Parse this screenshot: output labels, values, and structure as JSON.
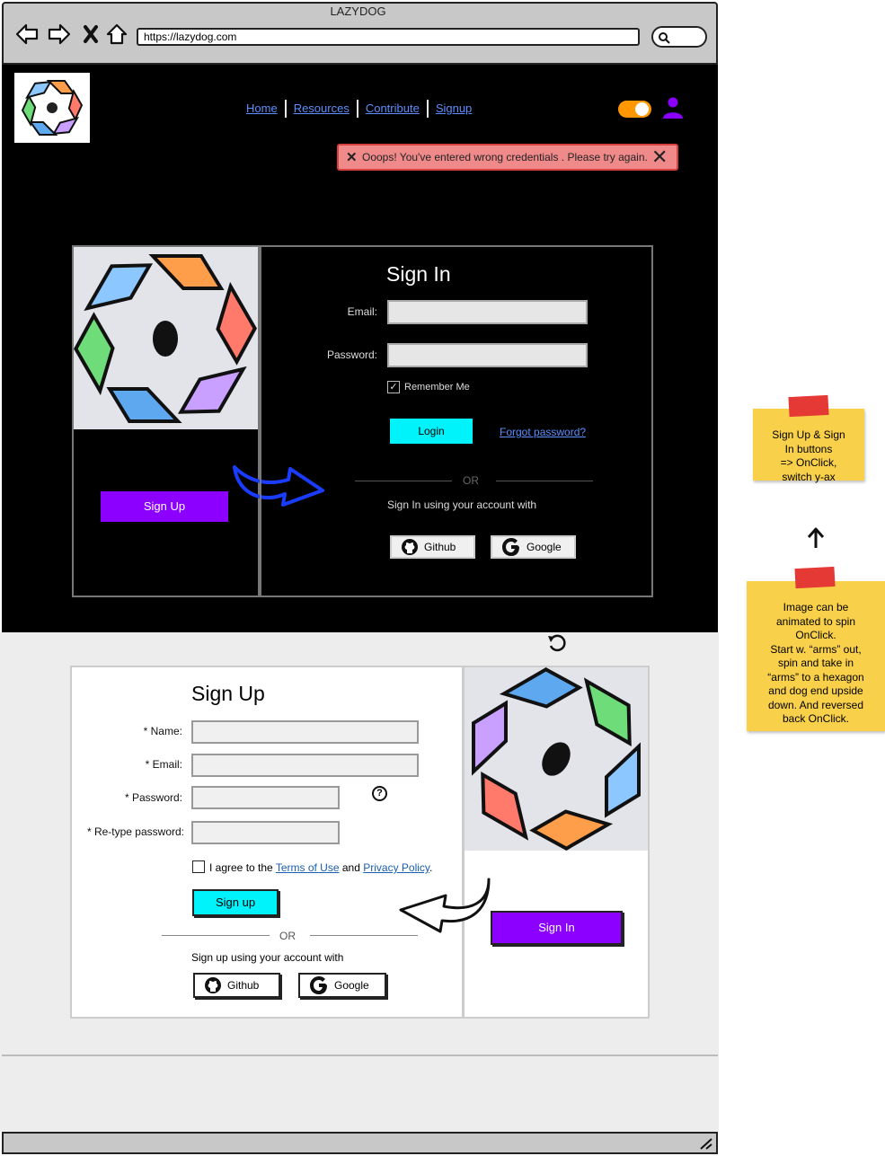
{
  "browser": {
    "title": "LAZYDOG",
    "url": "https://lazydog.com"
  },
  "nav": {
    "items": [
      "Home",
      "Resources",
      "Contribute",
      "Signup"
    ]
  },
  "alert": {
    "message": "Ooops! You've entered wrong credentials . Please try again."
  },
  "signin": {
    "title": "Sign In",
    "email_label": "Email:",
    "password_label": "Password:",
    "remember_label": "Remember Me",
    "remember_checked": true,
    "login_label": "Login",
    "forgot_label": "Forgot password?",
    "or_label": "OR",
    "social_text": "Sign In using your account with",
    "github_label": "Github",
    "google_label": "Google",
    "switch_label": "Sign Up"
  },
  "signup": {
    "title": "Sign Up",
    "name_label": "* Name:",
    "email_label": "* Email:",
    "password_label": "* Password:",
    "repassword_label": "* Re-type password:",
    "agree_prefix": "I agree to the ",
    "terms_label": "Terms of Use",
    "agree_and": " and ",
    "privacy_label": "Privacy Policy",
    "agree_suffix": ".",
    "signup_label": "Sign up",
    "or_label": "OR",
    "social_text": "Sign up using your account with",
    "github_label": "Github",
    "google_label": "Google",
    "switch_label": "Sign In"
  },
  "notes": {
    "note1": [
      "Sign Up & Sign",
      "In buttons",
      "=> OnClick,",
      "switch y-ax"
    ],
    "note2": [
      "Image can be",
      "animated to spin",
      "OnClick.",
      "Start w. “arms” out,",
      "spin and take in",
      "“arms” to a hexagon",
      "and dog end upside",
      "down. And reversed",
      "back OnClick."
    ]
  },
  "colors": {
    "accent_purple": "#8b00ff",
    "accent_cyan": "#00f2fa",
    "toggle_orange": "#ff9800",
    "alert_bg": "#f08a8a",
    "link_blue": "#5b8fff"
  }
}
